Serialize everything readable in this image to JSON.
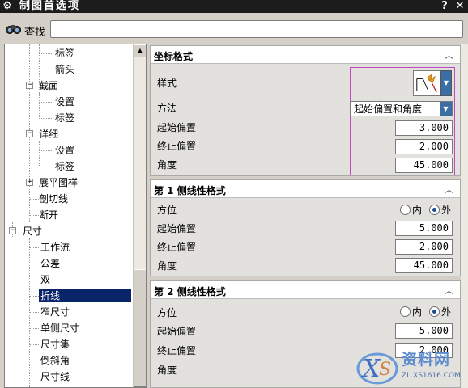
{
  "window": {
    "title": "制图首选项",
    "buttons": {
      "help": "?",
      "close": "✕"
    }
  },
  "search": {
    "label": "查找",
    "value": ""
  },
  "tree": {
    "items": [
      {
        "label": "标签"
      },
      {
        "label": "箭头"
      },
      {
        "label": "截面",
        "toggle": "−"
      },
      {
        "label": "设置"
      },
      {
        "label": "标签"
      },
      {
        "label": "详细",
        "toggle": "−"
      },
      {
        "label": "设置"
      },
      {
        "label": "标签"
      },
      {
        "label": "展平图样",
        "toggle": "+"
      },
      {
        "label": "剖切线"
      },
      {
        "label": "断开"
      },
      {
        "label": "尺寸",
        "toggle": "−"
      },
      {
        "label": "工作流"
      },
      {
        "label": "公差"
      },
      {
        "label": "双"
      },
      {
        "label": "折线",
        "selected": true
      },
      {
        "label": "窄尺寸"
      },
      {
        "label": "单侧尺寸"
      },
      {
        "label": "尺寸集"
      },
      {
        "label": "倒斜角"
      },
      {
        "label": "尺寸线"
      }
    ]
  },
  "sections": {
    "coordinate_format": {
      "title": "坐标格式",
      "style_label": "样式",
      "method_label": "方法",
      "method_value": "起始偏置和角度",
      "start_offset_label": "起始偏置",
      "start_offset_value": "3.000",
      "end_offset_label": "终止偏置",
      "end_offset_value": "2.000",
      "angle_label": "角度",
      "angle_value": "45.000"
    },
    "side1_format": {
      "title": "第 1 侧线性格式",
      "direction_label": "方位",
      "inner_label": "内",
      "outer_label": "外",
      "selected": "outer",
      "start_offset_label": "起始偏置",
      "start_offset_value": "5.000",
      "end_offset_label": "终止偏置",
      "end_offset_value": "2.000",
      "angle_label": "角度",
      "angle_value": "45.000"
    },
    "side2_format": {
      "title": "第 2 侧线性格式",
      "direction_label": "方位",
      "inner_label": "内",
      "outer_label": "外",
      "selected": "outer",
      "start_offset_label": "起始偏置",
      "start_offset_value": "5.000",
      "end_offset_label": "终止偏置",
      "end_offset_value": "2.000",
      "angle_label": "角度"
    }
  },
  "watermark": {
    "text": "资料网",
    "url": "ZL.XS1616.COM"
  },
  "colors": {
    "selection": "#0a246a",
    "highlight_border": "#c048c0",
    "dropdown": "#3a6ea5"
  }
}
